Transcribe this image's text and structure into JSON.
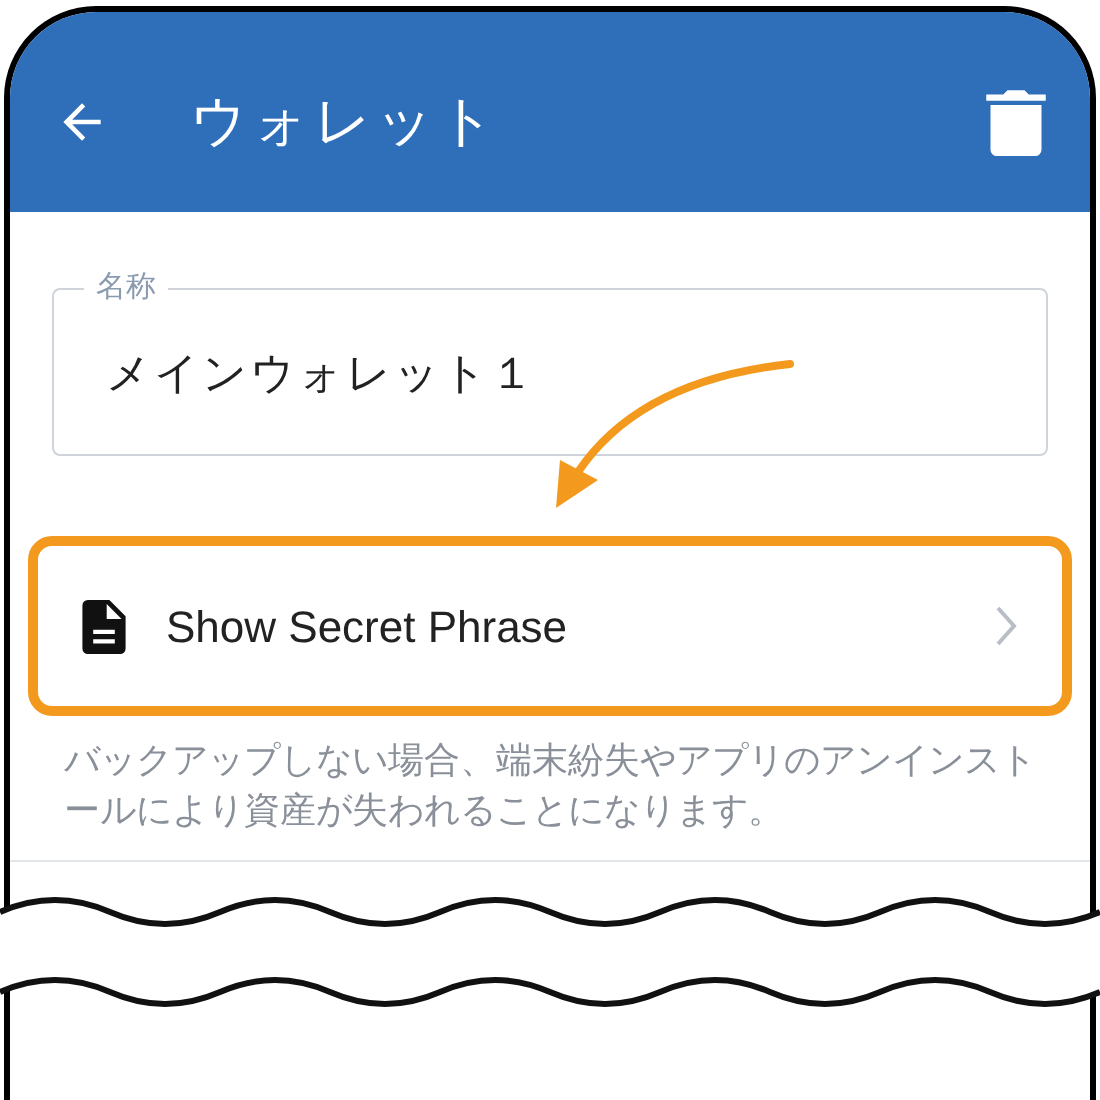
{
  "app_bar": {
    "title": "ウォレット"
  },
  "name_field": {
    "label": "名称",
    "value": "メインウォレット１"
  },
  "secret_phrase_row": {
    "label": "Show Secret Phrase",
    "highlighted": true
  },
  "helper_text": "バックアップしない場合、端末紛失やアプリのアンインストールにより資産が失われることになります。"
}
